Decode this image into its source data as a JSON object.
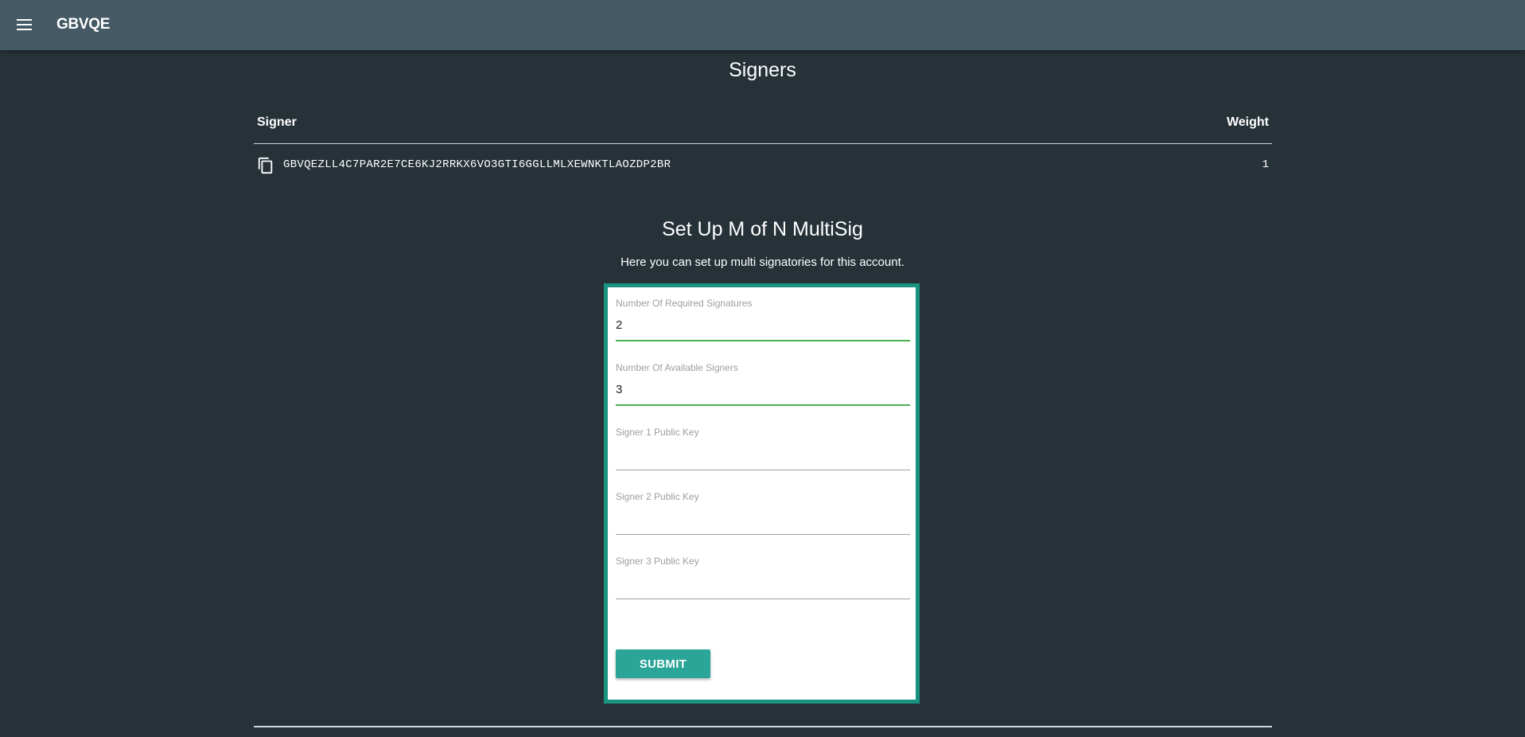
{
  "appbar": {
    "title": "GBVQE",
    "menu_icon": "hamburger-menu-icon"
  },
  "signers": {
    "title": "Signers",
    "columns": [
      "Signer",
      "Weight"
    ],
    "rows": [
      {
        "icon": "copy-icon",
        "key": "GBVQEZLL4C7PAR2E7CE6KJ2RRKX6VO3GTI6GGLLMLXEWNKTLAOZDP2BR",
        "weight": "1"
      }
    ]
  },
  "multisig": {
    "title": "Set Up M of N MultiSig",
    "subtitle": "Here you can set up multi signatories for this account.",
    "fields": [
      {
        "label": "Number Of Required Signatures",
        "value": "2",
        "placeholder": ""
      },
      {
        "label": "Number Of Available Signers",
        "value": "3",
        "placeholder": ""
      },
      {
        "label": "Signer 1 Public Key",
        "value": "",
        "placeholder": ""
      },
      {
        "label": "Signer 2 Public Key",
        "value": "",
        "placeholder": ""
      },
      {
        "label": "Signer 3 Public Key",
        "value": "",
        "placeholder": ""
      }
    ],
    "submit_label": "SUBMIT"
  },
  "colors": {
    "appbar": "#455a64",
    "background": "#263238",
    "card_border": "#1a9482",
    "button": "#2ba597",
    "active_underline": "#4caf50"
  }
}
